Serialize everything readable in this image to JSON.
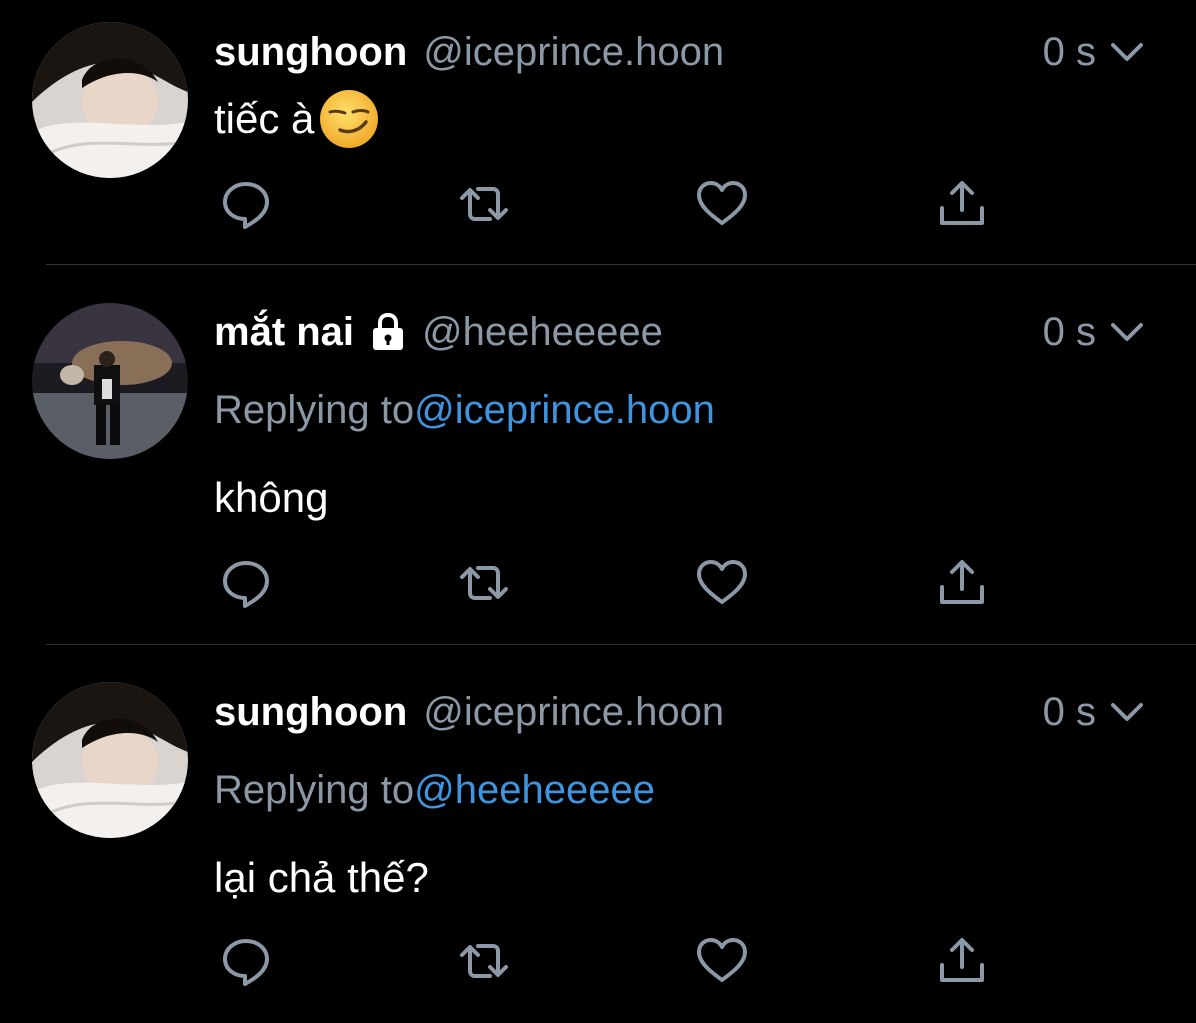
{
  "tweets": [
    {
      "name": "sunghoon",
      "handle": "@iceprince.hoon",
      "time": "0 s",
      "locked": false,
      "replying_prefix": "",
      "replying_handle": "",
      "text": "tiếc à",
      "emoji": "smirking-face"
    },
    {
      "name": "mắt nai",
      "handle": "@heeheeeee",
      "time": "0 s",
      "locked": true,
      "replying_prefix": "Replying to",
      "replying_handle": "@iceprince.hoon",
      "text": "không"
    },
    {
      "name": "sunghoon",
      "handle": "@iceprince.hoon",
      "time": "0 s",
      "locked": false,
      "replying_prefix": "Replying to",
      "replying_handle": "@heeheeeee",
      "text": "lại chả thế?"
    }
  ],
  "icons": {
    "reply": "reply-icon",
    "retweet": "retweet-icon",
    "like": "heart-icon",
    "share": "share-icon",
    "menu": "chevron-down-icon",
    "lock": "lock-icon"
  },
  "colors": {
    "background": "#000000",
    "text": "#ffffff",
    "secondary": "#8b98a5",
    "link": "#3f94e0",
    "divider": "#2f3336"
  }
}
